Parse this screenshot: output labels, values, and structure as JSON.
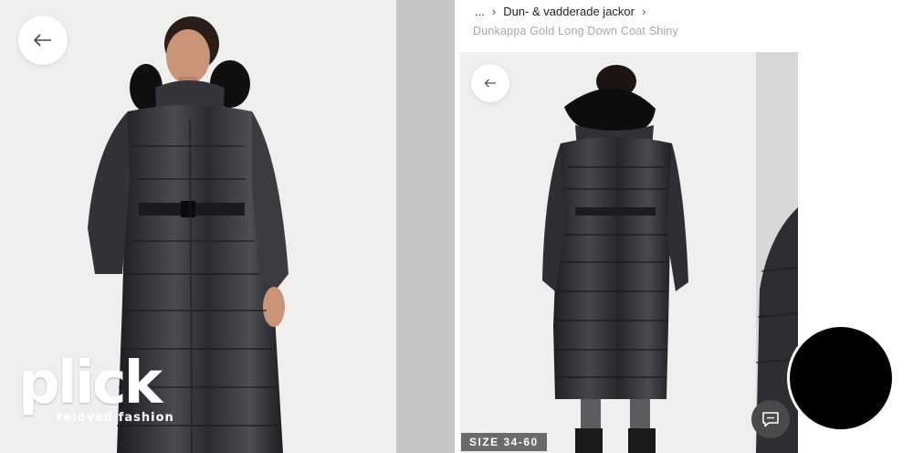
{
  "left_panel": {
    "back_icon": "arrow-left-icon",
    "logo": {
      "word": "plick",
      "tagline": "reloved fashion"
    }
  },
  "right_panel": {
    "breadcrumb": {
      "ellipsis": "...",
      "category": "Dun- & vadderade jackor"
    },
    "product_title": "Dunkappa Gold Long Down Coat Shiny",
    "gallery": {
      "back_icon": "arrow-left-icon",
      "size_badge": "SIZE 34-60",
      "chat_icon": "chat-bubble-icon"
    }
  },
  "overlay": {
    "record_button_color": "#000000"
  },
  "colors": {
    "coat": "#2b2c30",
    "fur": "#0e0e0e",
    "background": "#efefed"
  }
}
